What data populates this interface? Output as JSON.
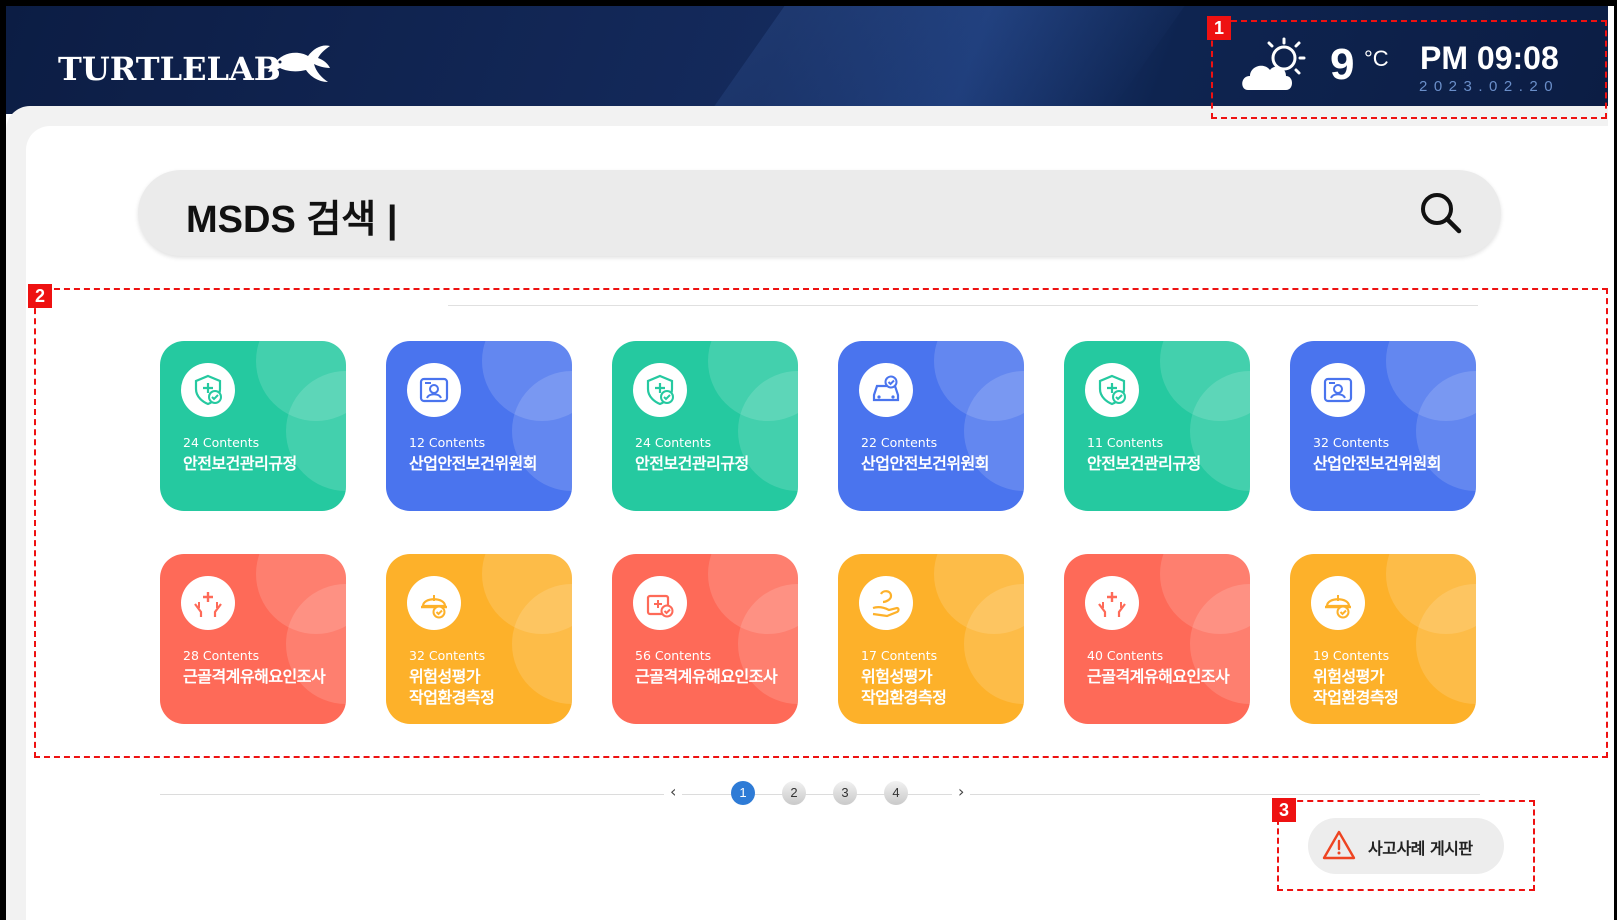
{
  "header": {
    "logo_text": "TURTLELAB",
    "weather_icon": "partly-cloudy-icon",
    "temperature": "9",
    "temperature_unit": "°C",
    "time": "PM 09:08",
    "date": "2023.02.20"
  },
  "search": {
    "label": "MSDS 검색 |",
    "placeholder": "",
    "icon": "search-icon"
  },
  "cards_row1": [
    {
      "count": "24 Contents",
      "title": "안전보건관리규정",
      "icon": "shield-check-icon",
      "color": "#25c9a0"
    },
    {
      "count": "12 Contents",
      "title": "산업안전보건위원회",
      "icon": "id-card-icon",
      "color": "#4a74ee"
    },
    {
      "count": "24 Contents",
      "title": "안전보건관리규정",
      "icon": "shield-check-icon",
      "color": "#25c9a0"
    },
    {
      "count": "22 Contents",
      "title": "산업안전보건위원회",
      "icon": "vehicle-check-icon",
      "color": "#4a74ee"
    },
    {
      "count": "11 Contents",
      "title": "안전보건관리규정",
      "icon": "shield-check-icon",
      "color": "#25c9a0"
    },
    {
      "count": "32 Contents",
      "title": "산업안전보건위원회",
      "icon": "id-card-icon",
      "color": "#4a74ee"
    }
  ],
  "cards_row2": [
    {
      "count": "28 Contents",
      "title_line1": "근골격계유해요인조사",
      "title_line2": "",
      "icon": "hands-medical-icon",
      "color": "#fe6a58"
    },
    {
      "count": "32 Contents",
      "title_line1": "위험성평가",
      "title_line2": "작업환경측정",
      "icon": "hardhat-check-icon",
      "color": "#fdb12a"
    },
    {
      "count": "56 Contents",
      "title_line1": "근골격계유해요인조사",
      "title_line2": "",
      "icon": "injury-check-icon",
      "color": "#fe6a58"
    },
    {
      "count": "17 Contents",
      "title_line1": "위험성평가",
      "title_line2": "작업환경측정",
      "icon": "hand-care-icon",
      "color": "#fdb12a"
    },
    {
      "count": "40 Contents",
      "title_line1": "근골격계유해요인조사",
      "title_line2": "",
      "icon": "hands-medical-icon",
      "color": "#fe6a58"
    },
    {
      "count": "19 Contents",
      "title_line1": "위험성평가",
      "title_line2": "작업환경측정",
      "icon": "hardhat-check-icon",
      "color": "#fdb12a"
    }
  ],
  "pagination": {
    "prev": "‹",
    "next": "›",
    "pages": [
      "1",
      "2",
      "3",
      "4"
    ],
    "current": "1"
  },
  "accident_board": {
    "label": "사고사례 게시판",
    "icon": "warning-triangle-icon"
  },
  "annotations": [
    "1",
    "2",
    "3"
  ],
  "colors": {
    "header_bg": "#0c1d44",
    "annotation": "#ee1111",
    "active_page": "#2e7bd6"
  }
}
